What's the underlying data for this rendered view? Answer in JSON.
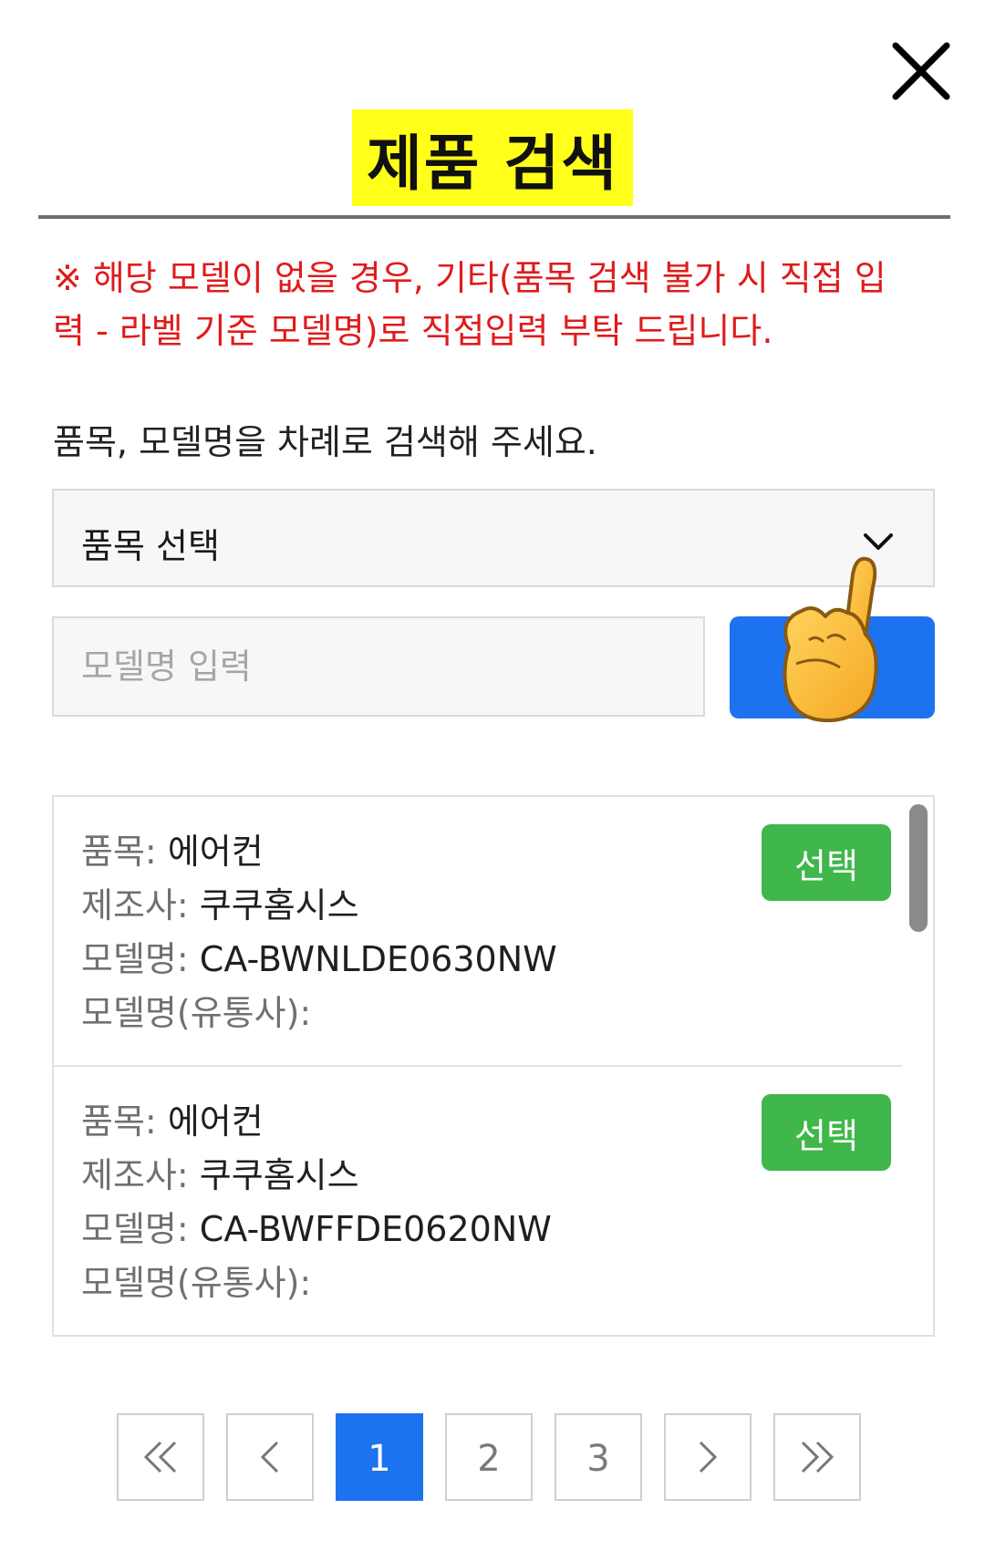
{
  "header": {
    "title": "제품 검색",
    "close_icon": "close-icon"
  },
  "notice": {
    "text": "※ 해당 모델이 없을 경우, 기타(품목 검색 불가 시 직접 입력 - 라벨 기준 모델명)로 직접입력 부탁 드립니다.",
    "color": "#e01b1b"
  },
  "instruction": "품목, 모델명을 차례로 검색해 주세요.",
  "category_select": {
    "value": "품목 선택",
    "icon": "chevron-down-icon"
  },
  "model_input": {
    "value": "",
    "placeholder": "모델명 입력"
  },
  "search_button": {
    "color": "#1d72f0",
    "overlay_icon": "pointing-hand-icon"
  },
  "results": [
    {
      "category_label": "품목:",
      "category": "에어컨",
      "maker_label": "제조사:",
      "maker": "쿠쿠홈시스",
      "model_label": "모델명:",
      "model": "CA-BWNLDE0630NW",
      "dist_model_label": "모델명(유통사):",
      "dist_model": "",
      "select_label": "선택"
    },
    {
      "category_label": "품목:",
      "category": "에어컨",
      "maker_label": "제조사:",
      "maker": "쿠쿠홈시스",
      "model_label": "모델명:",
      "model": "CA-BWFFDE0620NW",
      "dist_model_label": "모델명(유통사):",
      "dist_model": "",
      "select_label": "선택"
    }
  ],
  "pagination": {
    "first_icon": "double-chevron-left-icon",
    "prev_icon": "chevron-left-icon",
    "pages": [
      "1",
      "2",
      "3"
    ],
    "current": "1",
    "next_icon": "chevron-right-icon",
    "last_icon": "double-chevron-right-icon"
  },
  "colors": {
    "accent_blue": "#1d72f0",
    "select_green": "#3fb74a",
    "title_highlight": "#ffff1a"
  }
}
